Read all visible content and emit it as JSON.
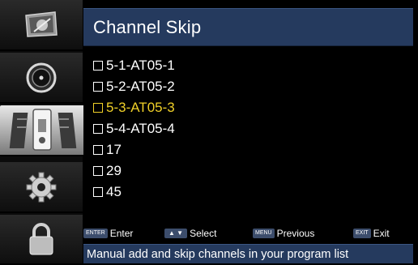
{
  "colors": {
    "header_bg": "#253a5e",
    "selected_text": "#f0d028",
    "background": "#000000"
  },
  "sidebar": {
    "items": [
      {
        "icon": "picture-icon",
        "active": false
      },
      {
        "icon": "audio-icon",
        "active": false
      },
      {
        "icon": "channel-antenna-icon",
        "active": true
      },
      {
        "icon": "gear-icon",
        "active": false
      },
      {
        "icon": "lock-icon",
        "active": false
      }
    ]
  },
  "header": {
    "title": "Channel Skip"
  },
  "channels": [
    {
      "label": "5-1-AT05-1",
      "checked": false,
      "selected": false
    },
    {
      "label": "5-2-AT05-2",
      "checked": false,
      "selected": false
    },
    {
      "label": "5-3-AT05-3",
      "checked": false,
      "selected": true
    },
    {
      "label": "5-4-AT05-4",
      "checked": false,
      "selected": false
    },
    {
      "label": "17",
      "checked": false,
      "selected": false
    },
    {
      "label": "29",
      "checked": false,
      "selected": false
    },
    {
      "label": "45",
      "checked": false,
      "selected": false
    }
  ],
  "help": {
    "enter_key": "ENTER",
    "enter_label": "Enter",
    "select_key": "▲ ▼",
    "select_label": "Select",
    "menu_key": "MENU",
    "menu_label": "Previous",
    "exit_key": "EXIT",
    "exit_label": "Exit"
  },
  "status": {
    "text": "Manual add and skip channels in your program list"
  }
}
